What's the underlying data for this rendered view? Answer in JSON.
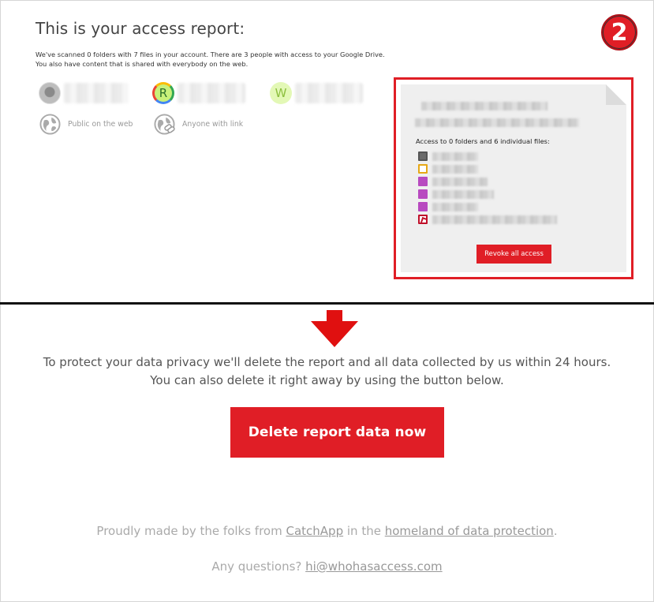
{
  "report": {
    "title": "This is your access report:",
    "summary_line1": "We've scanned 0 folders with 7 files in your account. There are 3 people with access to your Google Drive.",
    "summary_line2": "You also have content that is shared with everybody on the web."
  },
  "badge": {
    "number": "2",
    "color": "#e01e26"
  },
  "people": [
    {
      "initial": "",
      "icon": "anonymous-avatar-icon"
    },
    {
      "initial": "R",
      "icon": "avatar-r"
    },
    {
      "initial": "W",
      "icon": "avatar-w"
    }
  ],
  "sharing": {
    "public_label": "Public on the web",
    "link_label": "Anyone with link"
  },
  "file_card": {
    "access_text": "Access to 0 folders and 6 individual files:",
    "file_icons": [
      "doc-icon",
      "slides-icon",
      "image-icon",
      "image-icon",
      "image-icon",
      "pdf-icon"
    ],
    "revoke_label": "Revoke all access"
  },
  "notice": {
    "line1": "To protect your data privacy we'll delete the report and all data collected by us within 24 hours.",
    "line2": "You can also delete it right away by using the button below."
  },
  "delete_button": {
    "label": "Delete report data now"
  },
  "footer": {
    "made_prefix": "Proudly made by the folks from ",
    "catchapp_link": "CatchApp",
    "made_middle": " in the ",
    "homeland_link": "homeland of data protection",
    "made_suffix": ".",
    "questions_prefix": "Any questions? ",
    "email_link": "hi@whohasaccess.com"
  },
  "colors": {
    "accent": "#e01e26",
    "divider": "#111111"
  }
}
